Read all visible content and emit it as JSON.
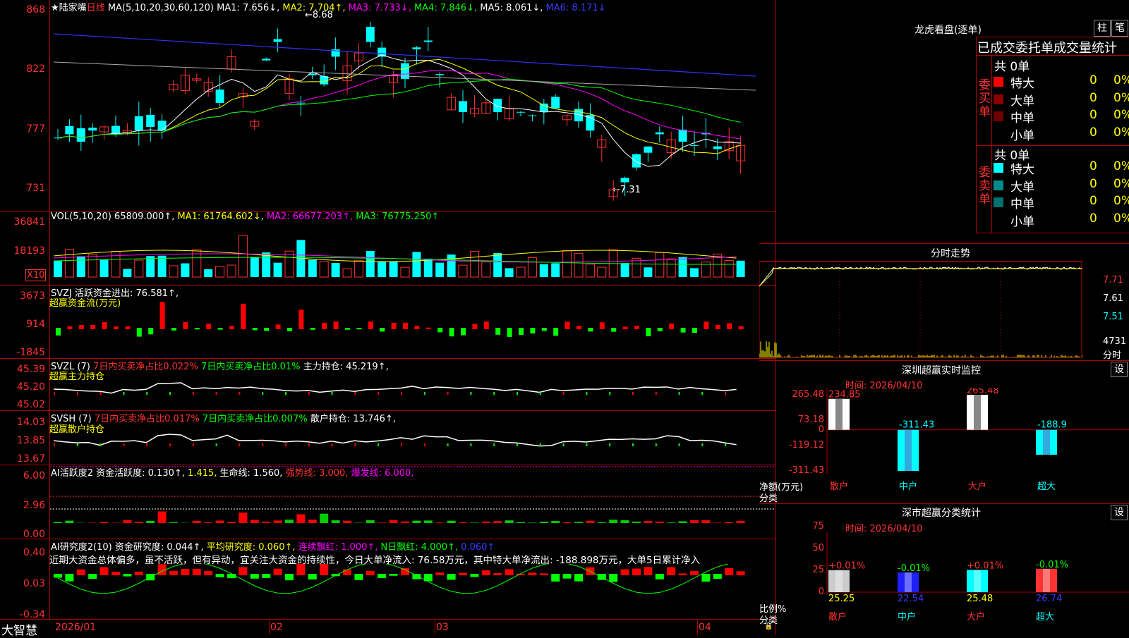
{
  "main": {
    "title": "★陆家嘴",
    "period": "日线",
    "ma_header": "MA(5,10,20,30,60,120)",
    "ma1": "MA1: 7.656↓,",
    "ma2": "MA2: 7.704↑,",
    "ma3": "MA3: 7.733↓,",
    "ma4": "MA4: 7.846↓,",
    "ma5": "MA5: 8.061↓,",
    "ma6": "MA6: 8.171↓",
    "high_annotation": "←8.68",
    "low_annotation": "←7.31",
    "y_labels": [
      "868",
      "822",
      "777",
      "731"
    ]
  },
  "volume": {
    "header": "VOL(5,10,20)",
    "value": "65809.000↑,",
    "ma1": "MA1: 61764.602↓,",
    "ma2": "MA2: 66677.203↑,",
    "ma3": "MA3: 76775.250↑",
    "y_labels": [
      "36841",
      "18193"
    ],
    "multiplier": "X10"
  },
  "svzj": {
    "header": "SVZJ  活跃资金进出: 76.581↑,",
    "subtitle": "超赢资金流(万元)",
    "y_labels": [
      "3673",
      "914",
      "-1845"
    ]
  },
  "svzl": {
    "header": "SVZL (7)",
    "t1": "7日内买卖净占比0.022%",
    "t2": "7日内买卖净占比0.01%",
    "t3": "主力持仓: 45.219↑,",
    "subtitle": "超赢主力持仓",
    "y_labels": [
      "45.39",
      "45.20",
      "45.02"
    ]
  },
  "svsh": {
    "header": "SVSH (7)",
    "t1": "7日内买卖净占比0.017%",
    "t2": "7日内买卖净占比0.007%",
    "t3": "散户持仓: 13.746↑,",
    "subtitle": "超赢散户持仓",
    "y_labels": [
      "14.03",
      "13.85",
      "13.67"
    ]
  },
  "ai_active": {
    "header": "AI活跃度2",
    "t1": "资金活跃度: 0.130↑,",
    "t2": "1.415,",
    "t3": "生命线: 1.560,",
    "t4": "强势线: 3.000,",
    "t5": "爆发线: 6.000,",
    "y_labels": [
      "6.00",
      "2.96",
      "0.00"
    ]
  },
  "ai_research": {
    "header": "AI研究度2(10)",
    "t1": "资金研究度: 0.044↑,",
    "t2": "平均研究度: 0.060↑,",
    "t3": "连续飘红: 1.000↑,",
    "t4": "N日飘红: 4.000↑,",
    "t5": "0.060↑",
    "comment": "近期大资金总体偏多，虽不活跃，但有异动，宜关注大资金的持续性，今日大单净流入: 76.58万元，其中特大单净流出: -188.898万元，大单5日累计净入",
    "y_labels": [
      "0.40",
      "0.03",
      "-0.34"
    ]
  },
  "bottom": {
    "brand": "大智慧",
    "dates": [
      "2026/01",
      "02",
      "03",
      "04"
    ]
  },
  "dragon": {
    "title": "龙虎看盘(逐单)",
    "btn1": "柱",
    "btn2": "笔",
    "subheader": "已成交委托单成交量统计",
    "buy_label": "委买单",
    "sell_label": "委卖单",
    "buy_total": "共 0单",
    "sell_total": "共 0单",
    "buy_rows": [
      {
        "label": "特大",
        "count": "0",
        "pct": "0%",
        "color": "#ff0000"
      },
      {
        "label": "大单",
        "count": "0",
        "pct": "0%",
        "color": "#8b0000"
      },
      {
        "label": "中单",
        "count": "0",
        "pct": "0%",
        "color": "#700000"
      },
      {
        "label": "小单",
        "count": "0",
        "pct": "0%",
        "color": "#000000"
      }
    ],
    "sell_rows": [
      {
        "label": "特大",
        "count": "0",
        "pct": "0%",
        "color": "#00ffff"
      },
      {
        "label": "大单",
        "count": "0",
        "pct": "0%",
        "color": "#008b8b"
      },
      {
        "label": "中单",
        "count": "0",
        "pct": "0%",
        "color": "#007070"
      },
      {
        "label": "小单",
        "count": "0",
        "pct": "0%",
        "color": "#000000"
      }
    ]
  },
  "intraday": {
    "title": "分时走势",
    "y_labels": [
      "7.71",
      "7.61",
      "7.51"
    ],
    "vol_label": "4731",
    "vol_unit": "分时"
  },
  "monitor": {
    "title": "深圳超赢实时监控",
    "time": "时间: 2026/04/10",
    "gear": "设",
    "y_labels": [
      "265.48",
      "73.18",
      "0",
      "-119.12",
      "-311.43"
    ],
    "unit1": "净额(万元)",
    "unit2": "分类",
    "categories": [
      "散户",
      "中户",
      "大户",
      "超大"
    ],
    "values": [
      234.85,
      -311.43,
      265.48,
      -188.9
    ],
    "value_labels": [
      "234.85",
      "-311.43",
      "265.48",
      "-188.9"
    ]
  },
  "classify": {
    "title": "深市超赢分类统计",
    "time": "时间: 2026/04/10",
    "gear": "设",
    "y_labels": [
      "75",
      "50",
      "25",
      "0"
    ],
    "unit1": "比例%",
    "unit2": "分类",
    "categories": [
      "散户",
      "中户",
      "大户",
      "超大"
    ],
    "values": [
      25.25,
      22.54,
      25.48,
      26.74
    ],
    "value_labels": [
      "25.25",
      "22.54",
      "25.48",
      "26.74"
    ],
    "changes": [
      "+0.01%",
      "-0.01%",
      "+0.01%",
      "-0.01%"
    ]
  }
}
